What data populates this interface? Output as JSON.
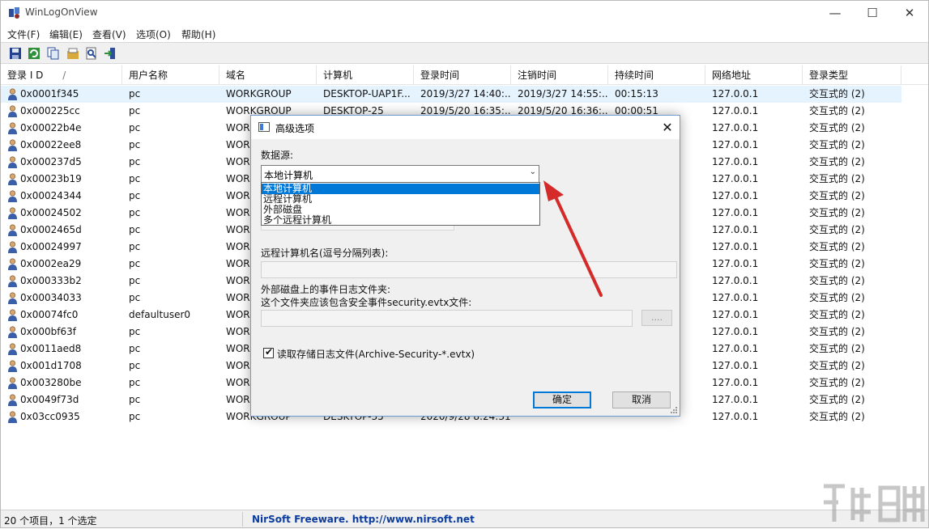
{
  "window": {
    "title": "WinLogOnView",
    "controls": {
      "minimize": "—",
      "maximize": "☐",
      "close": "✕"
    }
  },
  "menu": [
    "文件(F)",
    "编辑(E)",
    "查看(V)",
    "选项(O)",
    "帮助(H)"
  ],
  "toolbar": [
    "save-icon",
    "refresh-icon",
    "copy-icon",
    "properties-icon",
    "find-icon",
    "exit-icon"
  ],
  "columns": [
    "登录 I D",
    "用户名称",
    "域名",
    "计算机",
    "登录时间",
    "注销时间",
    "持续时间",
    "网络地址",
    "登录类型"
  ],
  "sort_indicator": "/",
  "rows": [
    {
      "id": "0x0001f345",
      "user": "pc",
      "domain": "WORKGROUP",
      "computer": "DESKTOP-UAP1F...",
      "logon": "2019/3/27 14:40:...",
      "logoff": "2019/3/27 14:55:...",
      "duration": "00:15:13",
      "address": "127.0.0.1",
      "type": "交互式的 (2)"
    },
    {
      "id": "0x000225cc",
      "user": "pc",
      "domain": "WORKGROUP",
      "computer": "DESKTOP-25",
      "logon": "2019/5/20 16:35:...",
      "logoff": "2019/5/20 16:36:...",
      "duration": "00:00:51",
      "address": "127.0.0.1",
      "type": "交互式的 (2)"
    },
    {
      "id": "0x00022b4e",
      "user": "pc",
      "domain": "WOR",
      "computer": "",
      "logon": "",
      "logoff": "",
      "duration": "",
      "address": "127.0.0.1",
      "type": "交互式的 (2)"
    },
    {
      "id": "0x00022ee8",
      "user": "pc",
      "domain": "WOR",
      "computer": "",
      "logon": "",
      "logoff": "",
      "duration": "",
      "address": "127.0.0.1",
      "type": "交互式的 (2)"
    },
    {
      "id": "0x000237d5",
      "user": "pc",
      "domain": "WOR",
      "computer": "",
      "logon": "",
      "logoff": "",
      "duration": "",
      "address": "127.0.0.1",
      "type": "交互式的 (2)"
    },
    {
      "id": "0x00023b19",
      "user": "pc",
      "domain": "WOR",
      "computer": "",
      "logon": "",
      "logoff": "",
      "duration": "",
      "address": "127.0.0.1",
      "type": "交互式的 (2)"
    },
    {
      "id": "0x00024344",
      "user": "pc",
      "domain": "WOR",
      "computer": "",
      "logon": "",
      "logoff": "",
      "duration": "",
      "address": "127.0.0.1",
      "type": "交互式的 (2)"
    },
    {
      "id": "0x00024502",
      "user": "pc",
      "domain": "WOR",
      "computer": "",
      "logon": "",
      "logoff": "",
      "duration": "",
      "address": "127.0.0.1",
      "type": "交互式的 (2)"
    },
    {
      "id": "0x0002465d",
      "user": "pc",
      "domain": "WOR",
      "computer": "",
      "logon": "",
      "logoff": "",
      "duration": "",
      "address": "127.0.0.1",
      "type": "交互式的 (2)"
    },
    {
      "id": "0x00024997",
      "user": "pc",
      "domain": "WOR",
      "computer": "",
      "logon": "",
      "logoff": "",
      "duration": "",
      "address": "127.0.0.1",
      "type": "交互式的 (2)"
    },
    {
      "id": "0x0002ea29",
      "user": "pc",
      "domain": "WOR",
      "computer": "",
      "logon": "",
      "logoff": "",
      "duration": "",
      "address": "127.0.0.1",
      "type": "交互式的 (2)"
    },
    {
      "id": "0x000333b2",
      "user": "pc",
      "domain": "WOR",
      "computer": "",
      "logon": "",
      "logoff": "",
      "duration": "",
      "address": "127.0.0.1",
      "type": "交互式的 (2)"
    },
    {
      "id": "0x00034033",
      "user": "pc",
      "domain": "WOR",
      "computer": "",
      "logon": "",
      "logoff": "",
      "duration": "",
      "address": "127.0.0.1",
      "type": "交互式的 (2)"
    },
    {
      "id": "0x00074fc0",
      "user": "defaultuser0",
      "domain": "WOR",
      "computer": "",
      "logon": "",
      "logoff": "",
      "duration": "",
      "address": "127.0.0.1",
      "type": "交互式的 (2)"
    },
    {
      "id": "0x000bf63f",
      "user": "pc",
      "domain": "WOR",
      "computer": "",
      "logon": "",
      "logoff": "",
      "duration": "",
      "address": "127.0.0.1",
      "type": "交互式的 (2)"
    },
    {
      "id": "0x0011aed8",
      "user": "pc",
      "domain": "WOR",
      "computer": "",
      "logon": "",
      "logoff": "",
      "duration": "",
      "address": "127.0.0.1",
      "type": "交互式的 (2)"
    },
    {
      "id": "0x001d1708",
      "user": "pc",
      "domain": "WOR",
      "computer": "",
      "logon": "",
      "logoff": "",
      "duration": "",
      "address": "127.0.0.1",
      "type": "交互式的 (2)"
    },
    {
      "id": "0x003280be",
      "user": "pc",
      "domain": "WOR",
      "computer": "",
      "logon": "",
      "logoff": "",
      "duration": "",
      "address": "127.0.0.1",
      "type": "交互式的 (2)"
    },
    {
      "id": "0x0049f73d",
      "user": "pc",
      "domain": "WOR",
      "computer": "",
      "logon": "",
      "logoff": "",
      "duration": "",
      "address": "127.0.0.1",
      "type": "交互式的 (2)"
    },
    {
      "id": "0x03cc0935",
      "user": "pc",
      "domain": "WORKGROUP",
      "computer": "DESKTOP-35",
      "logon": "2020/9/28 8:24:31",
      "logoff": "",
      "duration": "",
      "address": "127.0.0.1",
      "type": "交互式的 (2)"
    }
  ],
  "status": {
    "count": "20 个项目，1 个选定",
    "link": "NirSoft Freeware.  http://www.nirsoft.net"
  },
  "dialog": {
    "title": "高级选项",
    "close": "✕",
    "datasource_label": "数据源:",
    "datasource_value": "本地计算机",
    "datasource_options": [
      "本地计算机",
      "远程计算机",
      "外部磁盘",
      "多个远程计算机"
    ],
    "remote_label": "远程计算机名(逗号分隔列表):",
    "remote_value": "",
    "folder_label_1": "外部磁盘上的事件日志文件夹:",
    "folder_label_2": "这个文件夹应该包含安全事件security.evtx文件:",
    "folder_value": "",
    "browse_label": "....",
    "archive_checked": true,
    "archive_label": "读取存储日志文件(Archive-Security-*.evtx)",
    "ok_label": "确定",
    "cancel_label": "取消"
  },
  "colors": {
    "selection": "#e5f3ff",
    "accent": "#0078d7",
    "arrow": "#d42a2a",
    "link": "#0b3da0"
  }
}
